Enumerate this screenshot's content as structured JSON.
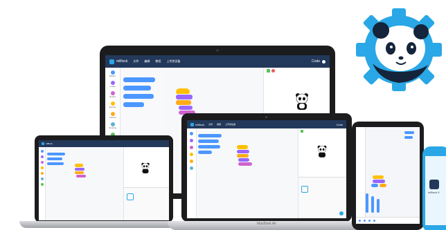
{
  "app": {
    "name": "mBlock",
    "menu": [
      "文件",
      "编辑",
      "教程",
      "上传到设备"
    ],
    "mode": "Code"
  },
  "categories": [
    {
      "label": "Motion",
      "color": "#4c97ff"
    },
    {
      "label": "Looks",
      "color": "#9966ff"
    },
    {
      "label": "Sound",
      "color": "#cf63cf"
    },
    {
      "label": "Events",
      "color": "#ffbf00"
    },
    {
      "label": "Control",
      "color": "#ffab19"
    },
    {
      "label": "Sensing",
      "color": "#5cb1d6"
    },
    {
      "label": "Operators",
      "color": "#59c059"
    }
  ],
  "macbook": {
    "brand": "MacBook Air"
  },
  "phone": {
    "app_label": "mBlock 5"
  },
  "colors": {
    "toolbar": "#23395b",
    "logo_gear": "#2aa7e6",
    "motion": "#4c97ff",
    "events": "#ffbf00",
    "looks": "#9966ff",
    "control": "#ffab19"
  }
}
